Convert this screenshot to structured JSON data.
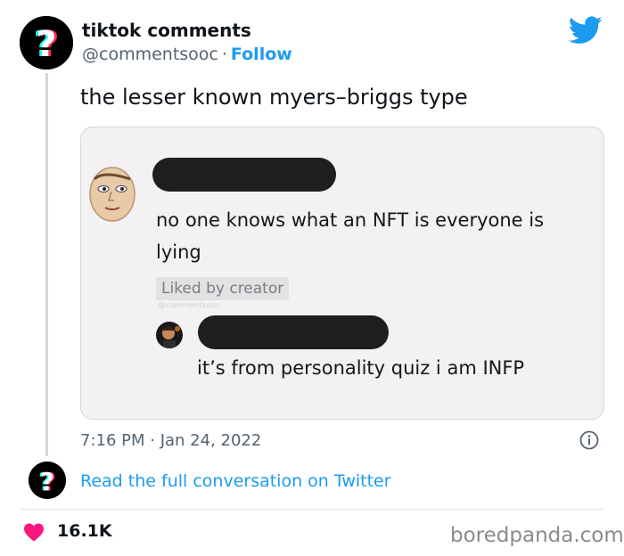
{
  "author": {
    "name": "tiktok comments",
    "handle": "@commentsooc",
    "separator": "·",
    "follow_label": "Follow",
    "avatar_icon": "tiktok-question-logo",
    "avatar_glyph": "?"
  },
  "tweet": {
    "text": "the lesser known myers–briggs type",
    "timestamp": "7:16 PM · Jan 24, 2022",
    "info_icon": "info-icon"
  },
  "media": {
    "comment_1": "no one knows what an NFT is everyone is lying",
    "liked_label": "Liked by creator",
    "watermark": "@commentsooc",
    "comment_2": "it’s from personality quiz i am INFP"
  },
  "footer": {
    "read_more": "Read the full conversation on Twitter",
    "likes": "16.1K",
    "credit": "boredpanda.com"
  },
  "colors": {
    "accent": "#1d9bf0",
    "heart": "#f91880",
    "text": "#0f1419",
    "muted": "#536471"
  }
}
